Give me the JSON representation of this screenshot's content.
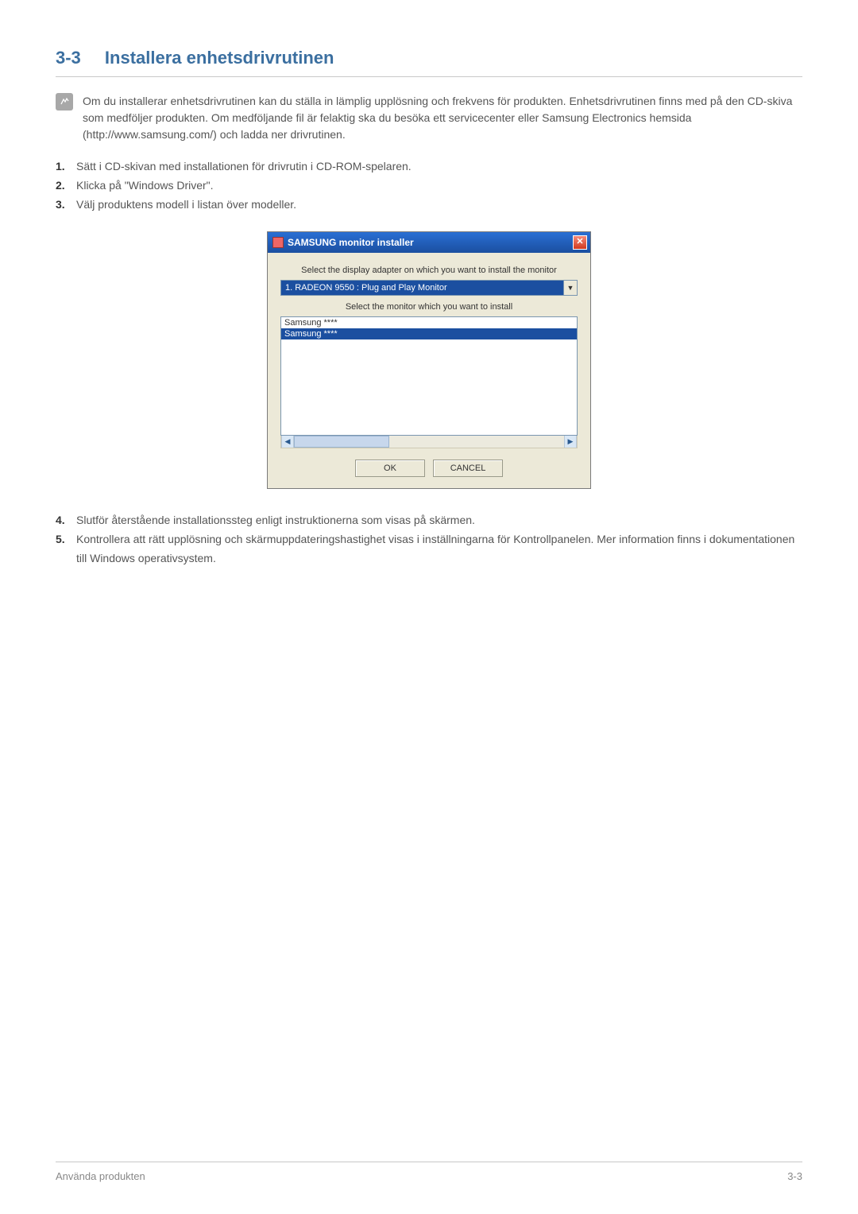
{
  "heading": {
    "number": "3-3",
    "title": "Installera enhetsdrivrutinen"
  },
  "note": "Om du installerar enhetsdrivrutinen kan du ställa in lämplig upplösning och frekvens för produkten. Enhetsdrivrutinen finns med på den CD-skiva som medföljer produkten. Om medföljande fil är felaktig ska du besöka ett servicecenter eller Samsung Electronics hemsida (http://www.samsung.com/) och ladda ner drivrutinen.",
  "steps_a": [
    "Sätt i CD-skivan med installationen för drivrutin i CD-ROM-spelaren.",
    "Klicka på \"Windows Driver\".",
    "Välj produktens modell i listan över modeller."
  ],
  "dialog": {
    "title": "SAMSUNG monitor installer",
    "label_adapter": "Select the display adapter on which you want to install the monitor",
    "adapter_value": "1. RADEON 9550 : Plug and Play Monitor",
    "label_monitor": "Select the monitor which you want to install",
    "list": [
      "Samsung ****",
      "Samsung ****"
    ],
    "selected_index": 1,
    "ok": "OK",
    "cancel": "CANCEL"
  },
  "steps_b": [
    "Slutför återstående installationssteg enligt instruktionerna som visas på skärmen.",
    "Kontrollera att rätt upplösning och skärmuppdateringshastighet visas i inställningarna för Kontrollpanelen. Mer information finns i dokumentationen till Windows operativsystem."
  ],
  "footer": {
    "left": "Använda produkten",
    "right": "3-3"
  }
}
